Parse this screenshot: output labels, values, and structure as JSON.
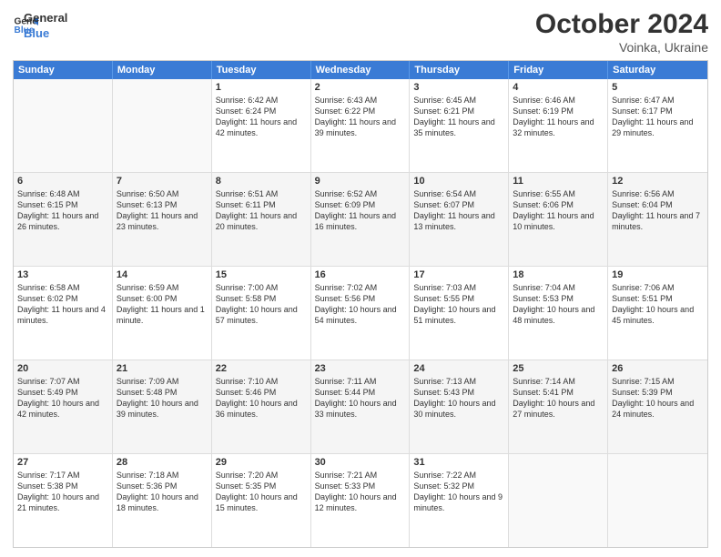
{
  "header": {
    "logo_general": "General",
    "logo_blue": "Blue",
    "month_title": "October 2024",
    "location": "Voinka, Ukraine"
  },
  "days_of_week": [
    "Sunday",
    "Monday",
    "Tuesday",
    "Wednesday",
    "Thursday",
    "Friday",
    "Saturday"
  ],
  "weeks": [
    [
      {
        "num": "",
        "info": "",
        "empty": true
      },
      {
        "num": "",
        "info": "",
        "empty": true
      },
      {
        "num": "1",
        "info": "Sunrise: 6:42 AM\nSunset: 6:24 PM\nDaylight: 11 hours and 42 minutes."
      },
      {
        "num": "2",
        "info": "Sunrise: 6:43 AM\nSunset: 6:22 PM\nDaylight: 11 hours and 39 minutes."
      },
      {
        "num": "3",
        "info": "Sunrise: 6:45 AM\nSunset: 6:21 PM\nDaylight: 11 hours and 35 minutes."
      },
      {
        "num": "4",
        "info": "Sunrise: 6:46 AM\nSunset: 6:19 PM\nDaylight: 11 hours and 32 minutes."
      },
      {
        "num": "5",
        "info": "Sunrise: 6:47 AM\nSunset: 6:17 PM\nDaylight: 11 hours and 29 minutes."
      }
    ],
    [
      {
        "num": "6",
        "info": "Sunrise: 6:48 AM\nSunset: 6:15 PM\nDaylight: 11 hours and 26 minutes."
      },
      {
        "num": "7",
        "info": "Sunrise: 6:50 AM\nSunset: 6:13 PM\nDaylight: 11 hours and 23 minutes."
      },
      {
        "num": "8",
        "info": "Sunrise: 6:51 AM\nSunset: 6:11 PM\nDaylight: 11 hours and 20 minutes."
      },
      {
        "num": "9",
        "info": "Sunrise: 6:52 AM\nSunset: 6:09 PM\nDaylight: 11 hours and 16 minutes."
      },
      {
        "num": "10",
        "info": "Sunrise: 6:54 AM\nSunset: 6:07 PM\nDaylight: 11 hours and 13 minutes."
      },
      {
        "num": "11",
        "info": "Sunrise: 6:55 AM\nSunset: 6:06 PM\nDaylight: 11 hours and 10 minutes."
      },
      {
        "num": "12",
        "info": "Sunrise: 6:56 AM\nSunset: 6:04 PM\nDaylight: 11 hours and 7 minutes."
      }
    ],
    [
      {
        "num": "13",
        "info": "Sunrise: 6:58 AM\nSunset: 6:02 PM\nDaylight: 11 hours and 4 minutes."
      },
      {
        "num": "14",
        "info": "Sunrise: 6:59 AM\nSunset: 6:00 PM\nDaylight: 11 hours and 1 minute."
      },
      {
        "num": "15",
        "info": "Sunrise: 7:00 AM\nSunset: 5:58 PM\nDaylight: 10 hours and 57 minutes."
      },
      {
        "num": "16",
        "info": "Sunrise: 7:02 AM\nSunset: 5:56 PM\nDaylight: 10 hours and 54 minutes."
      },
      {
        "num": "17",
        "info": "Sunrise: 7:03 AM\nSunset: 5:55 PM\nDaylight: 10 hours and 51 minutes."
      },
      {
        "num": "18",
        "info": "Sunrise: 7:04 AM\nSunset: 5:53 PM\nDaylight: 10 hours and 48 minutes."
      },
      {
        "num": "19",
        "info": "Sunrise: 7:06 AM\nSunset: 5:51 PM\nDaylight: 10 hours and 45 minutes."
      }
    ],
    [
      {
        "num": "20",
        "info": "Sunrise: 7:07 AM\nSunset: 5:49 PM\nDaylight: 10 hours and 42 minutes."
      },
      {
        "num": "21",
        "info": "Sunrise: 7:09 AM\nSunset: 5:48 PM\nDaylight: 10 hours and 39 minutes."
      },
      {
        "num": "22",
        "info": "Sunrise: 7:10 AM\nSunset: 5:46 PM\nDaylight: 10 hours and 36 minutes."
      },
      {
        "num": "23",
        "info": "Sunrise: 7:11 AM\nSunset: 5:44 PM\nDaylight: 10 hours and 33 minutes."
      },
      {
        "num": "24",
        "info": "Sunrise: 7:13 AM\nSunset: 5:43 PM\nDaylight: 10 hours and 30 minutes."
      },
      {
        "num": "25",
        "info": "Sunrise: 7:14 AM\nSunset: 5:41 PM\nDaylight: 10 hours and 27 minutes."
      },
      {
        "num": "26",
        "info": "Sunrise: 7:15 AM\nSunset: 5:39 PM\nDaylight: 10 hours and 24 minutes."
      }
    ],
    [
      {
        "num": "27",
        "info": "Sunrise: 7:17 AM\nSunset: 5:38 PM\nDaylight: 10 hours and 21 minutes."
      },
      {
        "num": "28",
        "info": "Sunrise: 7:18 AM\nSunset: 5:36 PM\nDaylight: 10 hours and 18 minutes."
      },
      {
        "num": "29",
        "info": "Sunrise: 7:20 AM\nSunset: 5:35 PM\nDaylight: 10 hours and 15 minutes."
      },
      {
        "num": "30",
        "info": "Sunrise: 7:21 AM\nSunset: 5:33 PM\nDaylight: 10 hours and 12 minutes."
      },
      {
        "num": "31",
        "info": "Sunrise: 7:22 AM\nSunset: 5:32 PM\nDaylight: 10 hours and 9 minutes."
      },
      {
        "num": "",
        "info": "",
        "empty": true
      },
      {
        "num": "",
        "info": "",
        "empty": true
      }
    ]
  ]
}
